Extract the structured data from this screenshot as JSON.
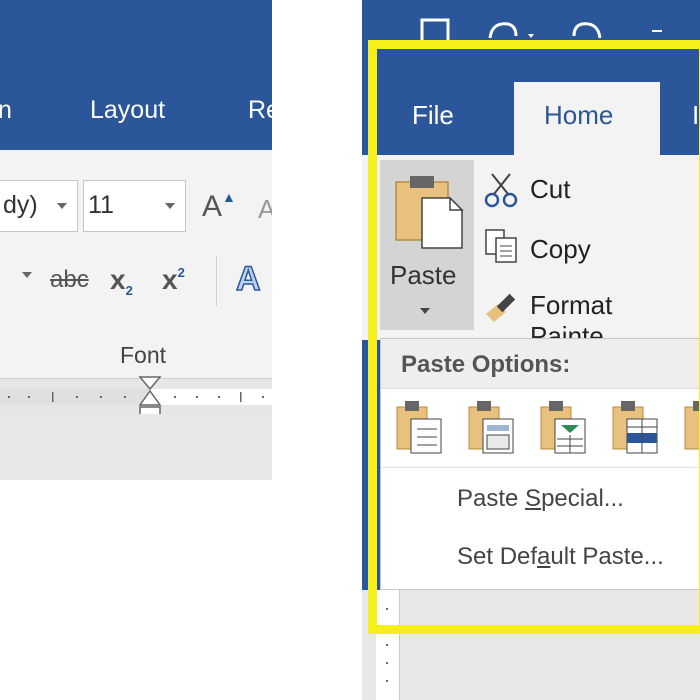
{
  "left": {
    "tabs": {
      "partial_left": "n",
      "layout": "Layout",
      "partial_right": "Re"
    },
    "font_name_partial": "dy)",
    "font_size": "11",
    "grow_font_glyph": "A",
    "format_glyphs": {
      "strike": "abc",
      "subscript": "x",
      "subscript_mark": "2",
      "superscript": "x",
      "superscript_mark": "2",
      "text_effects": "A"
    },
    "font_group_label": "Font"
  },
  "right": {
    "tabs": {
      "file": "File",
      "home": "Home",
      "partial": "I"
    },
    "clipboard": {
      "paste": "Paste",
      "cut": "Cut",
      "copy": "Copy",
      "format_painter": "Format Painte"
    },
    "paste_menu": {
      "header": "Paste Options:",
      "special_pre": "Paste ",
      "special_ul": "S",
      "special_post": "pecial...",
      "default_pre": "Set Def",
      "default_ul": "a",
      "default_post": "ult Paste..."
    }
  },
  "colors": {
    "word_blue": "#2b579a",
    "ribbon_grey": "#f3f3f3",
    "highlight_yellow": "#f7ef1a",
    "clipboard_tan": "#e9c17e"
  }
}
